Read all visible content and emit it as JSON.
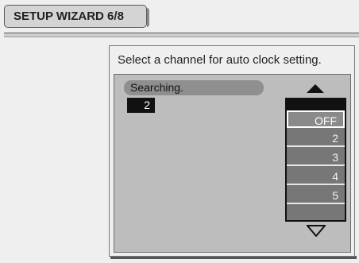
{
  "header": {
    "title": "SETUP WIZARD 6/8"
  },
  "dialog": {
    "instruction": "Select a channel for  auto clock setting.",
    "status": "Searching.",
    "current_channel": "2"
  },
  "channel_list": {
    "items": [
      "OFF",
      "2",
      "3",
      "4",
      "5"
    ],
    "selected": "OFF"
  },
  "icons": {
    "scroll_up": "triangle-up-icon",
    "scroll_down": "triangle-down-icon"
  }
}
